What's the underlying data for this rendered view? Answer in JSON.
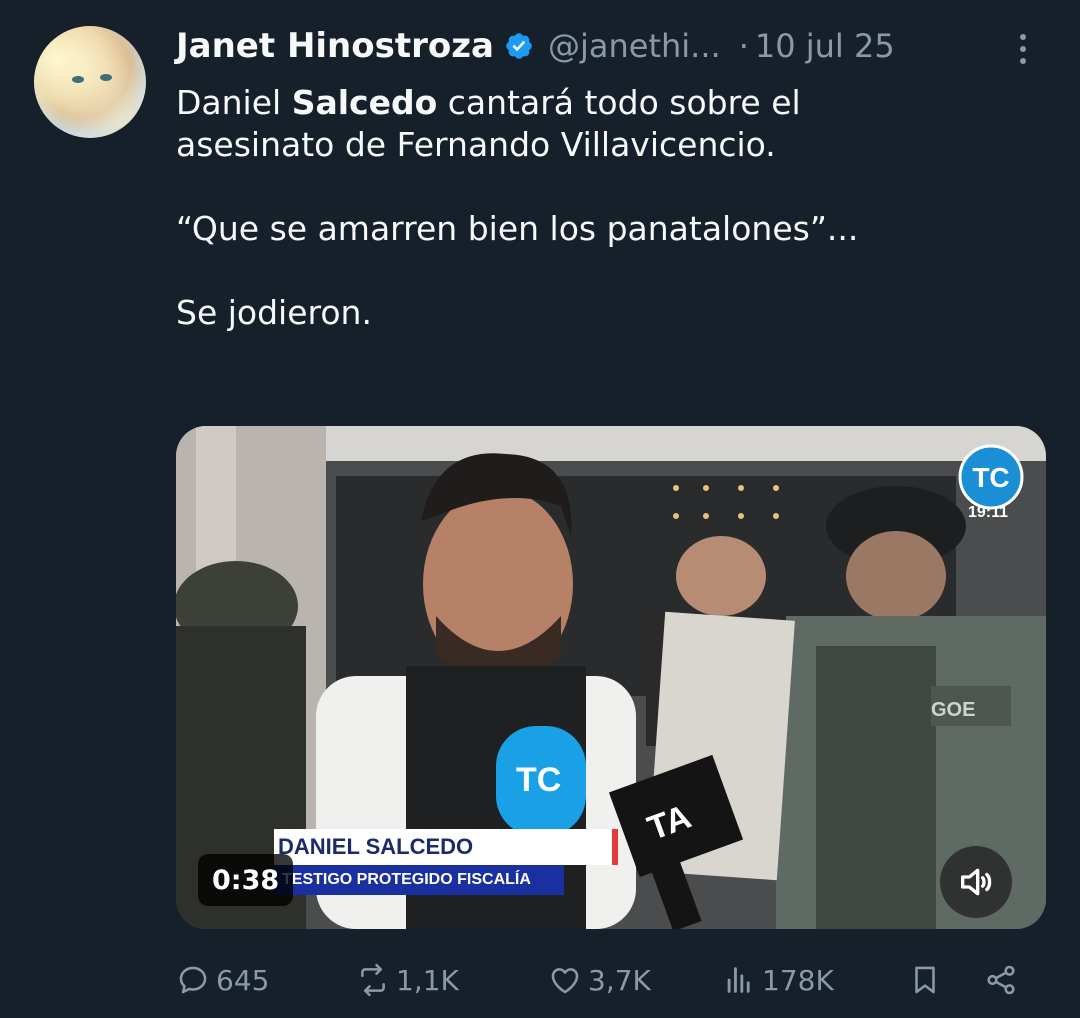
{
  "tweet": {
    "author_name": "Janet Hinostroza",
    "handle": "@janethi...",
    "separator": "·",
    "date": "10 jul 25",
    "line1_a": "Daniel ",
    "line1_b": "Salcedo",
    "line1_c": " cantará todo sobre el",
    "line2": "asesinato de Fernando Villavicencio.",
    "line3": "“Que se amarren bien los panatalones”...",
    "line4": "Se jodieron."
  },
  "media": {
    "duration": "0:38",
    "lower_third_name": "DANIEL SALCEDO",
    "lower_third_title": "TESTIGO PROTEGIDO FISCALÍA",
    "channel_clock": "19:11",
    "channel_logo_text": "TC",
    "mic_label_1": "TC",
    "mic_label_2": "TA",
    "vest_text": "GOE"
  },
  "actions": {
    "replies": "645",
    "reposts": "1,1K",
    "likes": "3,7K",
    "views": "178K"
  },
  "colors": {
    "background": "#15202b",
    "text_primary": "#f7f9f9",
    "text_secondary": "#8b98a5",
    "verified": "#1d9bf0"
  },
  "icons": [
    "verified-badge-icon",
    "more-options-icon",
    "reply-icon",
    "repost-icon",
    "like-icon",
    "views-icon",
    "bookmark-icon",
    "share-icon",
    "volume-icon"
  ]
}
